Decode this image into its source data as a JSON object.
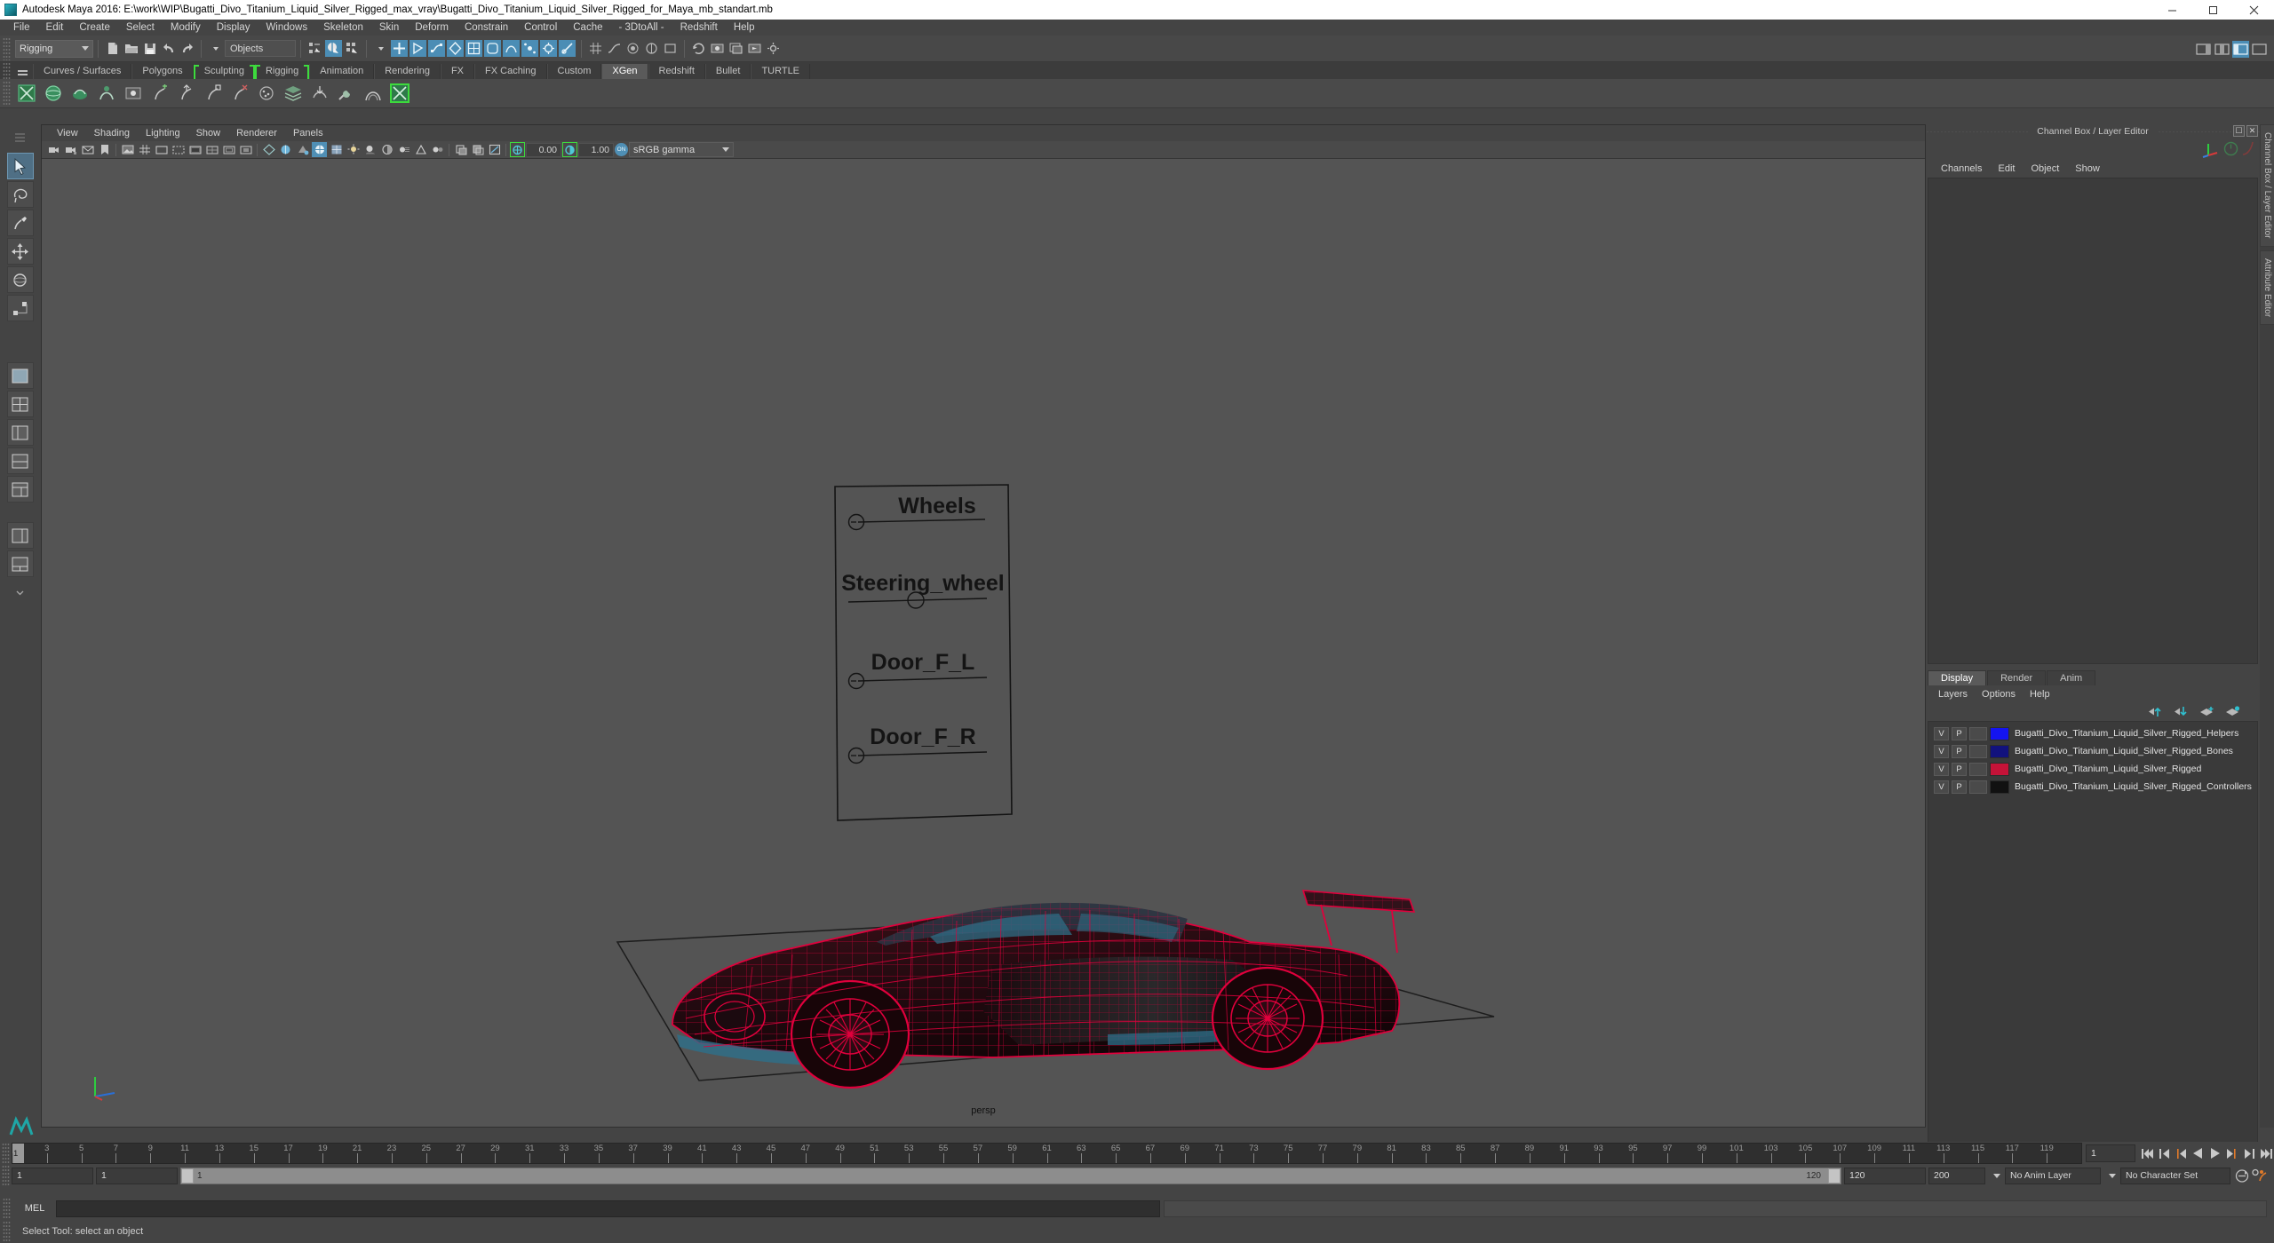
{
  "window": {
    "title": "Autodesk Maya 2016: E:\\work\\WIP\\Bugatti_Divo_Titanium_Liquid_Silver_Rigged_max_vray\\Bugatti_Divo_Titanium_Liquid_Silver_Rigged_for_Maya_mb_standart.mb",
    "minimize": "–",
    "maximize": "❐",
    "close": "✕"
  },
  "menubar": {
    "items": [
      "File",
      "Edit",
      "Create",
      "Select",
      "Modify",
      "Display",
      "Windows",
      "Skeleton",
      "Skin",
      "Deform",
      "Constrain",
      "Control",
      "Cache",
      "- 3DtoAll -",
      "Redshift",
      "Help"
    ]
  },
  "toolbar": {
    "menuset": "Rigging",
    "selection_mask": "Objects"
  },
  "shelf": {
    "tabs": [
      {
        "label": "Curves / Surfaces",
        "active": false,
        "bracket": false
      },
      {
        "label": "Polygons",
        "active": false,
        "bracket": false
      },
      {
        "label": "Sculpting",
        "active": false,
        "bracket": true
      },
      {
        "label": "Rigging",
        "active": false,
        "bracket": true
      },
      {
        "label": "Animation",
        "active": false,
        "bracket": false
      },
      {
        "label": "Rendering",
        "active": false,
        "bracket": false
      },
      {
        "label": "FX",
        "active": false,
        "bracket": false
      },
      {
        "label": "FX Caching",
        "active": false,
        "bracket": false
      },
      {
        "label": "Custom",
        "active": false,
        "bracket": false
      },
      {
        "label": "XGen",
        "active": true,
        "bracket": false
      },
      {
        "label": "Redshift",
        "active": false,
        "bracket": false
      },
      {
        "label": "Bullet",
        "active": false,
        "bracket": false
      },
      {
        "label": "TURTLE",
        "active": false,
        "bracket": false
      }
    ]
  },
  "viewport": {
    "menus": [
      "View",
      "Shading",
      "Lighting",
      "Show",
      "Renderer",
      "Panels"
    ],
    "exposure": "0.00",
    "gamma": "1.00",
    "view_transform": "sRGB gamma",
    "toggle_label": "ON",
    "camera_label": "persp",
    "annotations": [
      {
        "label": "Wheels"
      },
      {
        "label": "Steering_wheel"
      },
      {
        "label": "Door_F_L"
      },
      {
        "label": "Door_F_R"
      }
    ]
  },
  "channel_box": {
    "title": "Channel Box / Layer Editor",
    "menus": [
      "Channels",
      "Edit",
      "Object",
      "Show"
    ],
    "vertical_tabs": [
      "Channel Box / Layer Editor",
      "Attribute Editor"
    ]
  },
  "layer_editor": {
    "tabs": [
      {
        "label": "Display",
        "active": true
      },
      {
        "label": "Render",
        "active": false
      },
      {
        "label": "Anim",
        "active": false
      }
    ],
    "menus": [
      "Layers",
      "Options",
      "Help"
    ],
    "columns": [
      "V",
      "P"
    ],
    "layers": [
      {
        "visible": "V",
        "playback": "P",
        "color": "#1414f0",
        "name": "Bugatti_Divo_Titanium_Liquid_Silver_Rigged_Helpers"
      },
      {
        "visible": "V",
        "playback": "P",
        "color": "#12127d",
        "name": "Bugatti_Divo_Titanium_Liquid_Silver_Rigged_Bones"
      },
      {
        "visible": "V",
        "playback": "P",
        "color": "#c41338",
        "name": "Bugatti_Divo_Titanium_Liquid_Silver_Rigged"
      },
      {
        "visible": "V",
        "playback": "P",
        "color": "#111111",
        "name": "Bugatti_Divo_Titanium_Liquid_Silver_Rigged_Controllers"
      }
    ]
  },
  "time_slider": {
    "start": 1,
    "end": 120,
    "current_frame": "1",
    "tick_step": 2,
    "label_step": 2
  },
  "range_slider": {
    "anim_start": "1",
    "range_start": "1",
    "playback_marker": "1",
    "range_end": "120",
    "anim_end": "120",
    "max_end": "200",
    "anim_layer": "No Anim Layer",
    "character_set": "No Character Set"
  },
  "command_line": {
    "language": "MEL",
    "input_value": "",
    "output_value": ""
  },
  "status_bar": {
    "help_text": "Select Tool: select an object"
  },
  "colors": {
    "accent_blue": "#4b8db5",
    "shelf_green": "#3ddb3d",
    "wire_red": "#e0003c",
    "viewport_bg": "#545454"
  }
}
